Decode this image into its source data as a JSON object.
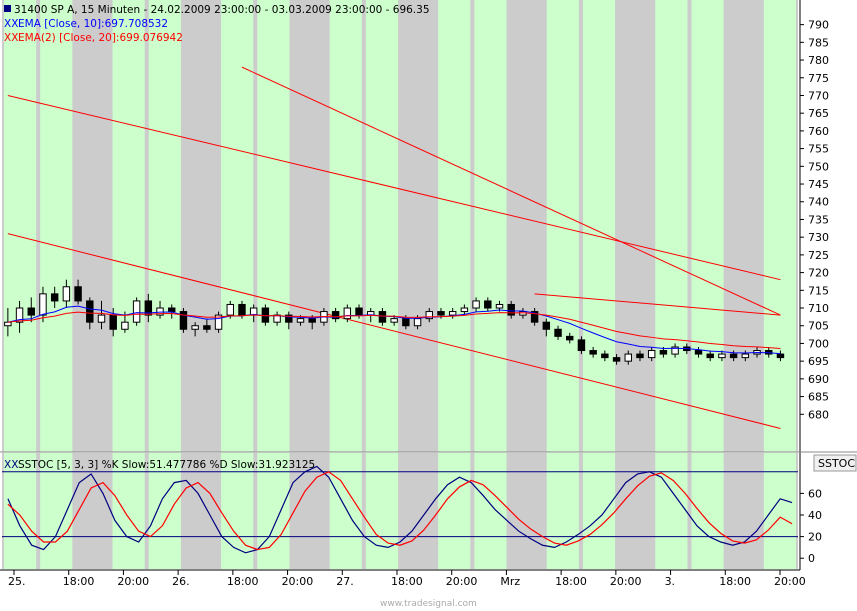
{
  "chart_data": {
    "type": "candlestick",
    "symbol_line": "31400  SP A, 15 Minuten - 24.02.2009 23:00:00 - 03.03.2009 23:00:00 - 696.35",
    "ema10_label": "EMA [Close, 10]:697.708532",
    "ema20_label": "EMA(2) [Close, 20]:699.076942",
    "ema10_value": 697.708532,
    "ema20_value": 699.076942,
    "last_close": 696.35,
    "ylim": [
      675,
      793
    ],
    "y_ticks": [
      680,
      685,
      690,
      695,
      700,
      705,
      710,
      715,
      720,
      725,
      730,
      735,
      740,
      745,
      750,
      755,
      760,
      765,
      770,
      775,
      780,
      785,
      790
    ],
    "x_tick_labels": [
      "25.",
      "18:00",
      "20:00",
      "26.",
      "18:00",
      "20:00",
      "27.",
      "18:00",
      "20:00",
      "Mrz",
      "18:00",
      "20:00",
      "3.",
      "18:00",
      "20:00"
    ],
    "green_sessions": [
      [
        0.5,
        15.5
      ],
      [
        41.5,
        67.5
      ],
      [
        90.5,
        116
      ],
      [
        138.5,
        164.5
      ],
      [
        185,
        207
      ],
      [
        233,
        252
      ],
      [
        275,
        299
      ]
    ],
    "candles": [
      [
        705,
        706,
        710,
        702
      ],
      [
        706,
        710,
        712,
        703
      ],
      [
        710,
        708,
        713,
        706
      ],
      [
        708,
        714,
        716,
        706
      ],
      [
        714,
        712,
        716,
        710
      ],
      [
        712,
        716,
        718,
        710
      ],
      [
        716,
        712,
        718,
        711
      ],
      [
        712,
        706,
        713,
        704
      ],
      [
        706,
        708,
        712,
        704
      ],
      [
        708,
        704,
        710,
        702
      ],
      [
        704,
        706,
        709,
        703
      ],
      [
        706,
        712,
        713,
        705
      ],
      [
        712,
        708,
        714,
        706
      ],
      [
        708,
        710,
        712,
        707
      ],
      [
        710,
        709,
        711,
        707
      ],
      [
        709,
        704,
        710,
        703
      ],
      [
        704,
        705,
        706,
        702
      ],
      [
        705,
        704,
        707,
        703
      ],
      [
        704,
        708,
        709,
        703
      ],
      [
        708,
        711,
        712,
        707
      ],
      [
        711,
        708,
        712,
        707
      ],
      [
        708,
        710,
        711,
        706
      ],
      [
        710,
        706,
        711,
        705
      ],
      [
        706,
        708,
        709,
        705
      ],
      [
        708,
        706,
        709,
        704
      ],
      [
        706,
        707,
        708,
        705
      ],
      [
        707,
        706,
        708,
        704
      ],
      [
        706,
        709,
        710,
        705
      ],
      [
        709,
        707,
        710,
        706
      ],
      [
        707,
        710,
        711,
        706
      ],
      [
        710,
        708,
        711,
        707
      ],
      [
        708,
        709,
        710,
        706
      ],
      [
        709,
        706,
        710,
        705
      ],
      [
        706,
        707,
        708,
        705
      ],
      [
        707,
        705,
        708,
        704
      ],
      [
        705,
        707,
        708,
        704
      ],
      [
        707,
        709,
        710,
        706
      ],
      [
        709,
        708,
        710,
        707
      ],
      [
        708,
        709,
        710,
        707
      ],
      [
        709,
        710,
        711,
        708
      ],
      [
        710,
        712,
        713,
        709
      ],
      [
        712,
        710,
        713,
        709
      ],
      [
        710,
        711,
        712,
        709
      ],
      [
        711,
        708,
        712,
        707
      ],
      [
        708,
        709,
        710,
        707
      ],
      [
        709,
        706,
        710,
        705
      ],
      [
        706,
        704,
        707,
        702
      ],
      [
        704,
        702,
        705,
        701
      ],
      [
        702,
        701,
        703,
        700
      ],
      [
        701,
        698,
        702,
        697
      ],
      [
        698,
        697,
        699,
        696
      ],
      [
        697,
        696,
        698,
        695
      ],
      [
        696,
        695,
        697,
        694
      ],
      [
        695,
        697,
        698,
        694
      ],
      [
        697,
        696,
        698,
        695
      ],
      [
        696,
        698,
        699,
        695
      ],
      [
        698,
        697,
        699,
        696
      ],
      [
        697,
        699,
        700,
        696
      ],
      [
        699,
        698,
        700,
        697
      ],
      [
        698,
        697,
        699,
        696
      ],
      [
        697,
        696,
        698,
        695
      ],
      [
        696,
        697,
        698,
        695
      ],
      [
        697,
        696,
        698,
        695
      ],
      [
        696,
        697,
        698,
        695
      ],
      [
        697,
        698,
        699,
        696
      ],
      [
        698,
        697,
        699,
        696
      ],
      [
        697,
        696,
        698,
        695
      ]
    ]
  },
  "stoch": {
    "label": "SSTOC [5, 3, 3] %K Slow:51.477786 %D Slow:31.923125",
    "k_value": 51.477786,
    "d_value": 31.923125,
    "axis_label": "SSTOC",
    "ylim": [
      -10,
      90
    ],
    "y_ticks": [
      0,
      20,
      40,
      60
    ],
    "levels": [
      80,
      20
    ],
    "k": [
      55,
      30,
      12,
      8,
      20,
      45,
      70,
      78,
      60,
      35,
      20,
      15,
      30,
      55,
      70,
      72,
      60,
      40,
      20,
      10,
      5,
      8,
      20,
      45,
      70,
      80,
      85,
      75,
      55,
      35,
      20,
      12,
      10,
      15,
      25,
      40,
      55,
      68,
      75,
      70,
      58,
      45,
      35,
      25,
      18,
      12,
      10,
      15,
      22,
      30,
      40,
      55,
      70,
      78,
      80,
      75,
      60,
      45,
      30,
      20,
      15,
      12,
      15,
      25,
      40,
      55,
      51.477786
    ],
    "d": [
      50,
      40,
      25,
      15,
      15,
      25,
      45,
      65,
      70,
      58,
      40,
      25,
      20,
      30,
      50,
      65,
      70,
      60,
      42,
      25,
      12,
      8,
      10,
      22,
      42,
      62,
      75,
      80,
      72,
      55,
      38,
      22,
      14,
      12,
      16,
      26,
      40,
      55,
      66,
      72,
      68,
      58,
      47,
      36,
      27,
      20,
      14,
      12,
      16,
      22,
      31,
      42,
      55,
      67,
      76,
      79,
      72,
      60,
      46,
      33,
      23,
      16,
      14,
      17,
      26,
      38,
      31.923125
    ]
  },
  "footer": {
    "brand": "www.tradesignal.com"
  },
  "colors": {
    "green_band": "#ccffcc",
    "gray_band": "#cccccc",
    "candle_up": "#ffffff",
    "candle_down": "#000000",
    "ema10": "#0000ff",
    "ema20": "#ff0000",
    "trend": "#ff0000",
    "stoch_k": "#000080",
    "stoch_d": "#ff0000"
  },
  "toolbar": {
    "close_glyph": "XX"
  }
}
